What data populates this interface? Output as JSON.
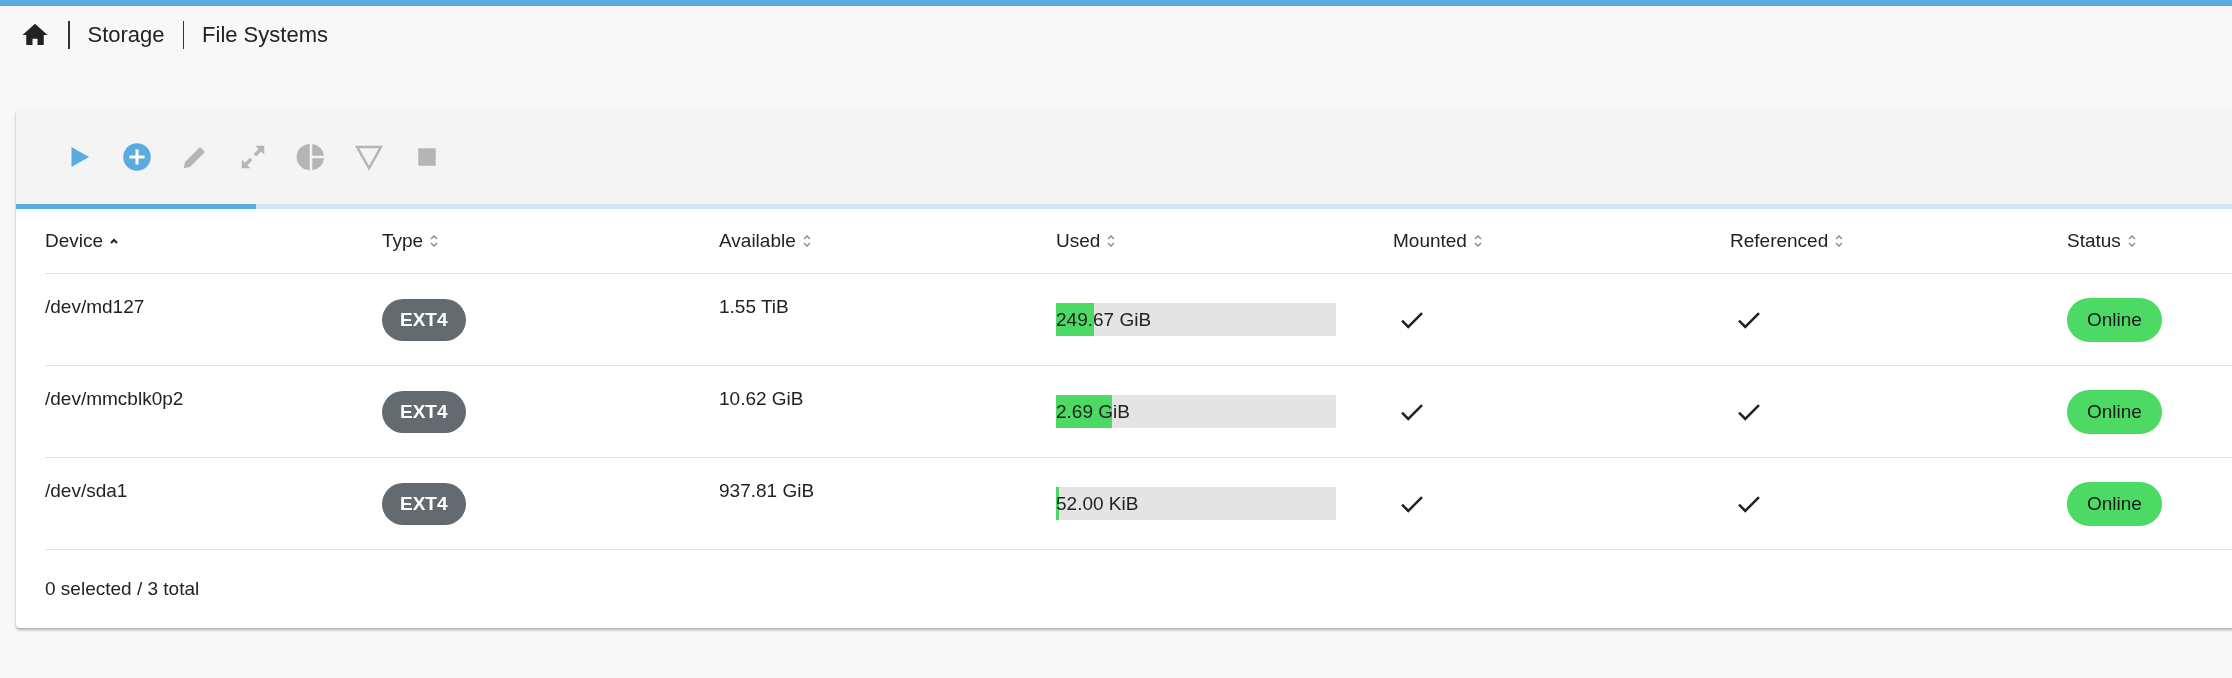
{
  "breadcrumb": {
    "items": [
      "Storage",
      "File Systems"
    ]
  },
  "toolbar": {
    "buttons": [
      {
        "kind": "play",
        "disabled": false
      },
      {
        "kind": "add",
        "disabled": false
      },
      {
        "kind": "edit",
        "disabled": true
      },
      {
        "kind": "resize",
        "disabled": true
      },
      {
        "kind": "pie",
        "disabled": true
      },
      {
        "kind": "filter",
        "disabled": true
      },
      {
        "kind": "stop",
        "disabled": true
      }
    ],
    "loading_bar": {
      "level": 0.1
    }
  },
  "table": {
    "columns": [
      {
        "label": "Device",
        "sorted": true
      },
      {
        "label": "Type",
        "sorted": false
      },
      {
        "label": "Available",
        "sorted": false
      },
      {
        "label": "Used",
        "sorted": false
      },
      {
        "label": "Mounted",
        "sorted": false
      },
      {
        "label": "Referenced",
        "sorted": false
      },
      {
        "label": "Status",
        "sorted": false
      }
    ],
    "rows": [
      {
        "device": "/dev/md127",
        "type": "EXT4",
        "available": "1.55 TiB",
        "used": "249.67 GiB",
        "level": 0.136,
        "mounted": true,
        "referenced": true,
        "status": "Online"
      },
      {
        "device": "/dev/mmcblk0p2",
        "type": "EXT4",
        "available": "10.62 GiB",
        "used": "2.69 GiB",
        "level": 0.2,
        "mounted": true,
        "referenced": true,
        "status": "Online"
      },
      {
        "device": "/dev/sda1",
        "type": "EXT4",
        "available": "937.81 GiB",
        "used": "52.00 KiB",
        "level": 0.01,
        "mounted": true,
        "referenced": true,
        "status": "Online"
      }
    ]
  },
  "footer": {
    "summary": "0 selected / 3 total"
  }
}
